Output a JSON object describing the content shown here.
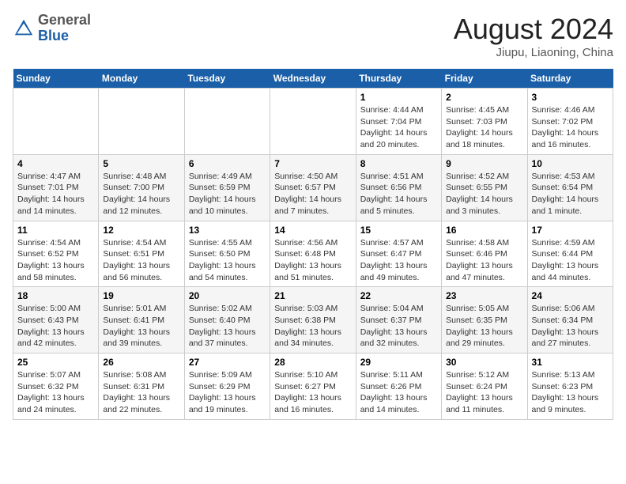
{
  "logo": {
    "general": "General",
    "blue": "Blue"
  },
  "title": "August 2024",
  "location": "Jiupu, Liaoning, China",
  "days_of_week": [
    "Sunday",
    "Monday",
    "Tuesday",
    "Wednesday",
    "Thursday",
    "Friday",
    "Saturday"
  ],
  "weeks": [
    [
      {
        "day": "",
        "info": ""
      },
      {
        "day": "",
        "info": ""
      },
      {
        "day": "",
        "info": ""
      },
      {
        "day": "",
        "info": ""
      },
      {
        "day": "1",
        "info": "Sunrise: 4:44 AM\nSunset: 7:04 PM\nDaylight: 14 hours\nand 20 minutes."
      },
      {
        "day": "2",
        "info": "Sunrise: 4:45 AM\nSunset: 7:03 PM\nDaylight: 14 hours\nand 18 minutes."
      },
      {
        "day": "3",
        "info": "Sunrise: 4:46 AM\nSunset: 7:02 PM\nDaylight: 14 hours\nand 16 minutes."
      }
    ],
    [
      {
        "day": "4",
        "info": "Sunrise: 4:47 AM\nSunset: 7:01 PM\nDaylight: 14 hours\nand 14 minutes."
      },
      {
        "day": "5",
        "info": "Sunrise: 4:48 AM\nSunset: 7:00 PM\nDaylight: 14 hours\nand 12 minutes."
      },
      {
        "day": "6",
        "info": "Sunrise: 4:49 AM\nSunset: 6:59 PM\nDaylight: 14 hours\nand 10 minutes."
      },
      {
        "day": "7",
        "info": "Sunrise: 4:50 AM\nSunset: 6:57 PM\nDaylight: 14 hours\nand 7 minutes."
      },
      {
        "day": "8",
        "info": "Sunrise: 4:51 AM\nSunset: 6:56 PM\nDaylight: 14 hours\nand 5 minutes."
      },
      {
        "day": "9",
        "info": "Sunrise: 4:52 AM\nSunset: 6:55 PM\nDaylight: 14 hours\nand 3 minutes."
      },
      {
        "day": "10",
        "info": "Sunrise: 4:53 AM\nSunset: 6:54 PM\nDaylight: 14 hours\nand 1 minute."
      }
    ],
    [
      {
        "day": "11",
        "info": "Sunrise: 4:54 AM\nSunset: 6:52 PM\nDaylight: 13 hours\nand 58 minutes."
      },
      {
        "day": "12",
        "info": "Sunrise: 4:54 AM\nSunset: 6:51 PM\nDaylight: 13 hours\nand 56 minutes."
      },
      {
        "day": "13",
        "info": "Sunrise: 4:55 AM\nSunset: 6:50 PM\nDaylight: 13 hours\nand 54 minutes."
      },
      {
        "day": "14",
        "info": "Sunrise: 4:56 AM\nSunset: 6:48 PM\nDaylight: 13 hours\nand 51 minutes."
      },
      {
        "day": "15",
        "info": "Sunrise: 4:57 AM\nSunset: 6:47 PM\nDaylight: 13 hours\nand 49 minutes."
      },
      {
        "day": "16",
        "info": "Sunrise: 4:58 AM\nSunset: 6:46 PM\nDaylight: 13 hours\nand 47 minutes."
      },
      {
        "day": "17",
        "info": "Sunrise: 4:59 AM\nSunset: 6:44 PM\nDaylight: 13 hours\nand 44 minutes."
      }
    ],
    [
      {
        "day": "18",
        "info": "Sunrise: 5:00 AM\nSunset: 6:43 PM\nDaylight: 13 hours\nand 42 minutes."
      },
      {
        "day": "19",
        "info": "Sunrise: 5:01 AM\nSunset: 6:41 PM\nDaylight: 13 hours\nand 39 minutes."
      },
      {
        "day": "20",
        "info": "Sunrise: 5:02 AM\nSunset: 6:40 PM\nDaylight: 13 hours\nand 37 minutes."
      },
      {
        "day": "21",
        "info": "Sunrise: 5:03 AM\nSunset: 6:38 PM\nDaylight: 13 hours\nand 34 minutes."
      },
      {
        "day": "22",
        "info": "Sunrise: 5:04 AM\nSunset: 6:37 PM\nDaylight: 13 hours\nand 32 minutes."
      },
      {
        "day": "23",
        "info": "Sunrise: 5:05 AM\nSunset: 6:35 PM\nDaylight: 13 hours\nand 29 minutes."
      },
      {
        "day": "24",
        "info": "Sunrise: 5:06 AM\nSunset: 6:34 PM\nDaylight: 13 hours\nand 27 minutes."
      }
    ],
    [
      {
        "day": "25",
        "info": "Sunrise: 5:07 AM\nSunset: 6:32 PM\nDaylight: 13 hours\nand 24 minutes."
      },
      {
        "day": "26",
        "info": "Sunrise: 5:08 AM\nSunset: 6:31 PM\nDaylight: 13 hours\nand 22 minutes."
      },
      {
        "day": "27",
        "info": "Sunrise: 5:09 AM\nSunset: 6:29 PM\nDaylight: 13 hours\nand 19 minutes."
      },
      {
        "day": "28",
        "info": "Sunrise: 5:10 AM\nSunset: 6:27 PM\nDaylight: 13 hours\nand 16 minutes."
      },
      {
        "day": "29",
        "info": "Sunrise: 5:11 AM\nSunset: 6:26 PM\nDaylight: 13 hours\nand 14 minutes."
      },
      {
        "day": "30",
        "info": "Sunrise: 5:12 AM\nSunset: 6:24 PM\nDaylight: 13 hours\nand 11 minutes."
      },
      {
        "day": "31",
        "info": "Sunrise: 5:13 AM\nSunset: 6:23 PM\nDaylight: 13 hours\nand 9 minutes."
      }
    ]
  ]
}
